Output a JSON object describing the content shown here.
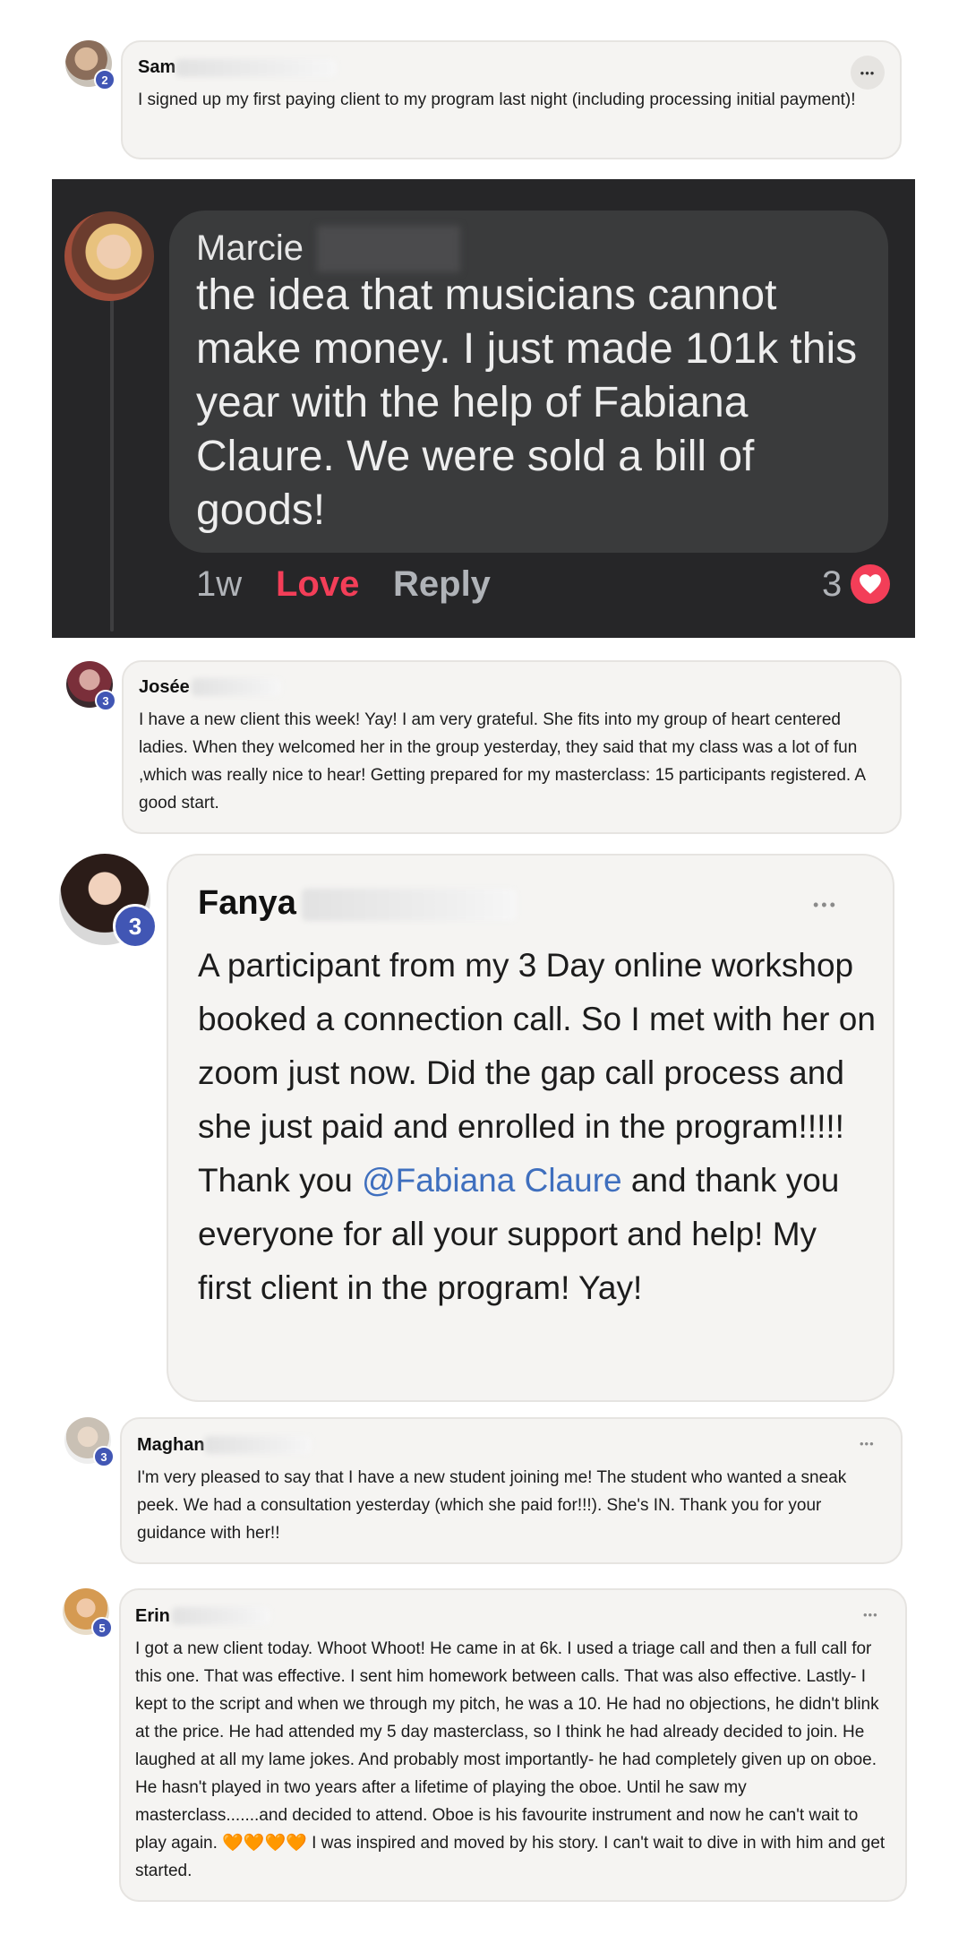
{
  "posts": [
    {
      "author": "Sam",
      "badge": "2",
      "text": "I signed up my first paying client to my program last night (including processing initial payment)!",
      "menu": "•••"
    },
    {
      "author": "Marcie",
      "text": "the idea that musicians cannot make money. I just made 101k this year with the help of Fabiana Claure. We were sold a bill of goods!",
      "time": "1w",
      "love_label": "Love",
      "reply_label": "Reply",
      "reaction_count": "3"
    },
    {
      "author": "Josée",
      "badge": "3",
      "text": "I have a new client this week! Yay! I am very grateful. She fits into my group of heart centered ladies. When they welcomed her in the group yesterday, they said that my class was a lot of fun ,which was really nice to hear! Getting prepared for my masterclass: 15 participants registered. A good start."
    },
    {
      "author": "Fanya",
      "badge": "3",
      "menu": "•••",
      "text_before": "A participant from my 3 Day online workshop booked a connection call. So I met with her on zoom just now. Did the gap call process and she just paid and enrolled in the program!!!!! Thank you ",
      "mention": "@Fabiana Claure",
      "text_after": " and thank you everyone for all your support and help! My first client in the program! Yay!"
    },
    {
      "author": "Maghan",
      "badge": "3",
      "menu": "•••",
      "text": "I'm very pleased to say that I have a new student joining me! The student who wanted a sneak peek. We had a consultation yesterday (which she paid for!!!). She's IN. Thank you for your guidance with her!!"
    },
    {
      "author": "Erin",
      "badge": "5",
      "menu": "•••",
      "text_before": "I got a new client today. Whoot Whoot! He came in at 6k. I used a triage call and then a full call for this one. That was effective. I sent him homework between calls. That was also effective. Lastly- I kept to the script and when we through my pitch, he was a 10. He had no objections, he didn't blink at the price. He had attended my 5 day masterclass, so I think he had already decided to join. He laughed at all my lame jokes. And probably most importantly- he had completely given up on oboe. He hasn't played in two years after a lifetime of playing the oboe. Until he saw my masterclass.......and decided to attend. Oboe is his favourite instrument and now he can't wait to play again. ",
      "emoji": "🧡🧡🧡🧡",
      "text_after": " I was inspired and moved by his story. I can't wait to dive in with him and get started."
    }
  ]
}
